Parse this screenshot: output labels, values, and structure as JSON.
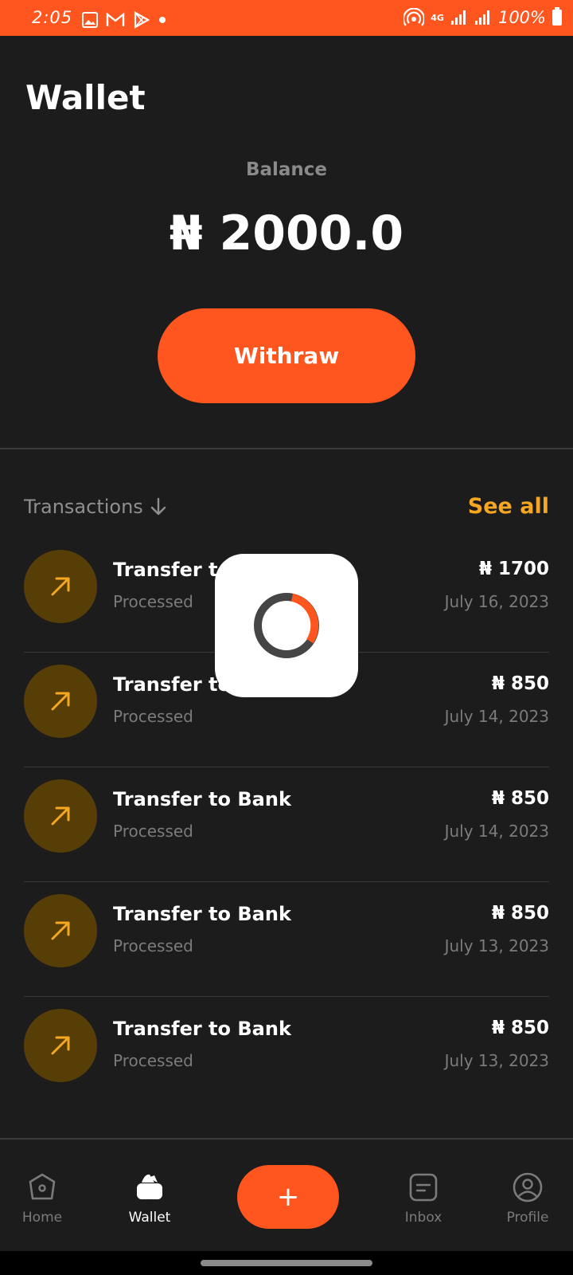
{
  "status_bar": {
    "time": "2:05",
    "battery": "100%",
    "network": "4G"
  },
  "header": {
    "title": "Wallet"
  },
  "balance": {
    "label": "Balance",
    "amount": "₦ 2000.0"
  },
  "withdraw_button": {
    "label": "Withraw"
  },
  "transactions": {
    "header": "Transactions",
    "see_all": "See all",
    "items": [
      {
        "title": "Transfer to",
        "status": "Processed",
        "amount": "₦ 1700",
        "date": "July 16, 2023"
      },
      {
        "title": "Transfer to",
        "status": "Processed",
        "amount": "₦ 850",
        "date": "July 14, 2023"
      },
      {
        "title": "Transfer to Bank",
        "status": "Processed",
        "amount": "₦ 850",
        "date": "July 14, 2023"
      },
      {
        "title": "Transfer to Bank",
        "status": "Processed",
        "amount": "₦ 850",
        "date": "July 13, 2023"
      },
      {
        "title": "Transfer to Bank",
        "status": "Processed",
        "amount": "₦ 850",
        "date": "July 13, 2023"
      }
    ]
  },
  "bottom_nav": {
    "items": [
      {
        "label": "Home",
        "icon": "home-icon"
      },
      {
        "label": "Wallet",
        "icon": "wallet-icon",
        "active": true
      },
      {
        "label": "+",
        "icon": "plus-icon"
      },
      {
        "label": "Inbox",
        "icon": "inbox-icon"
      },
      {
        "label": "Profile",
        "icon": "profile-icon"
      }
    ]
  },
  "colors": {
    "accent": "#ff551e",
    "link": "#f5a623",
    "background": "#1c1c1c",
    "icon_bg": "#573d06"
  }
}
